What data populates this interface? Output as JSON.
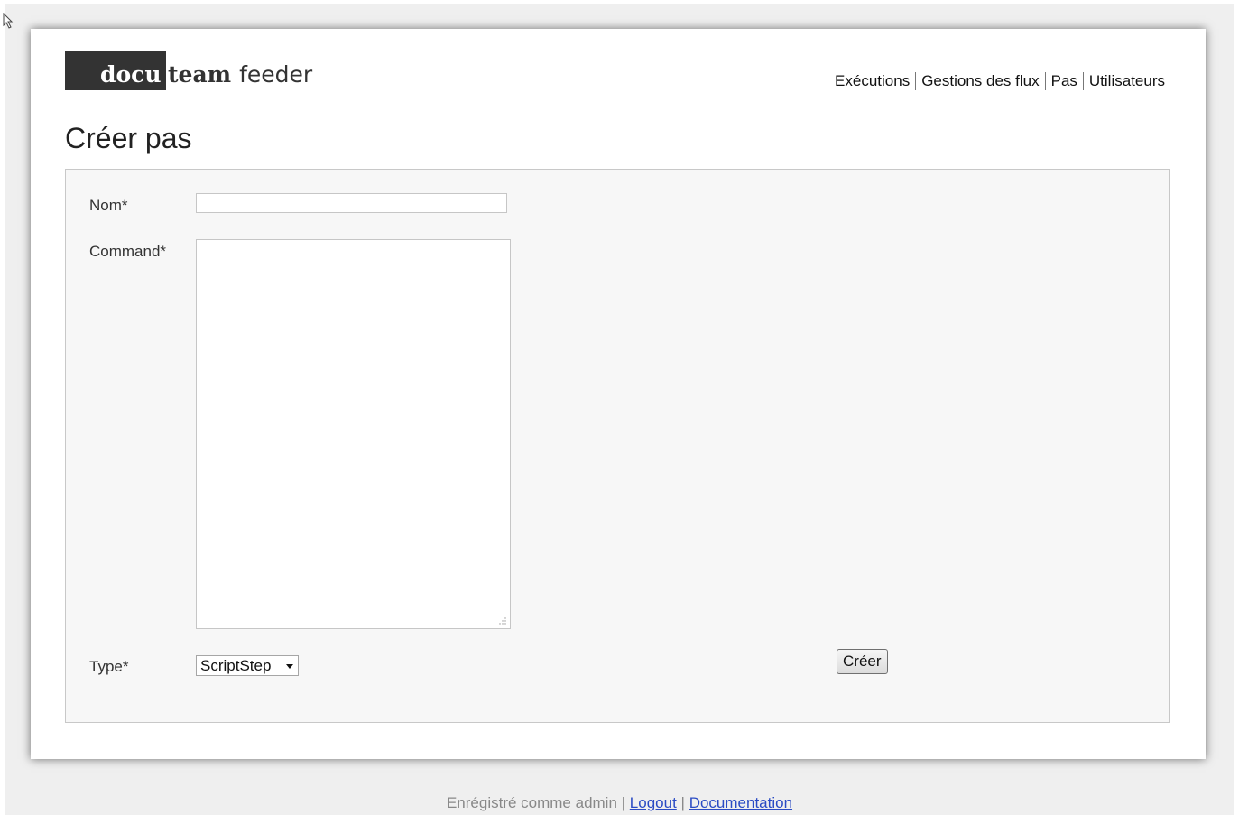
{
  "logo": {
    "part1": "docu",
    "part2": "team",
    "part3": "feeder"
  },
  "nav": {
    "items": [
      {
        "label": "Exécutions"
      },
      {
        "label": "Gestions des flux"
      },
      {
        "label": "Pas"
      },
      {
        "label": "Utilisateurs"
      }
    ]
  },
  "page": {
    "title": "Créer pas"
  },
  "form": {
    "nom_label": "Nom*",
    "nom_value": "",
    "command_label": "Command*",
    "command_value": "",
    "type_label": "Type*",
    "type_selected": "ScriptStep",
    "submit_label": "Créer"
  },
  "footer": {
    "logged_text": "Enrégistré comme admin |",
    "logout_label": "Logout",
    "separator": "|",
    "documentation_label": "Documentation"
  },
  "icons": {
    "cursor": "cursor-icon",
    "select_arrow": "chevron-down-icon",
    "resize": "resize-grip-icon"
  }
}
